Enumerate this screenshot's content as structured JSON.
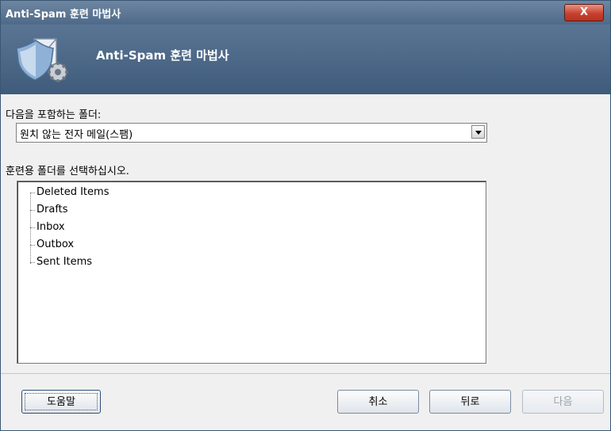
{
  "window": {
    "title": "Anti-Spam 훈련 마법사",
    "close_label": "X"
  },
  "header": {
    "title": "Anti-Spam 훈련 마법사",
    "logo_icon": "shield-envelope-gear-icon"
  },
  "form": {
    "folder_label": "다음을 포함하는 폴더:",
    "folder_value": "원치 않는 전자 메일(스팸)",
    "training_label": "훈련용 폴더를 선택하십시오."
  },
  "tree": {
    "items": [
      "Deleted Items",
      "Drafts",
      "Inbox",
      "Outbox",
      "Sent Items"
    ]
  },
  "buttons": {
    "help": "도움말",
    "cancel": "취소",
    "back": "뒤로",
    "next": "다음"
  },
  "colors": {
    "titlebar": "#5a7594",
    "close": "#c8412f"
  }
}
